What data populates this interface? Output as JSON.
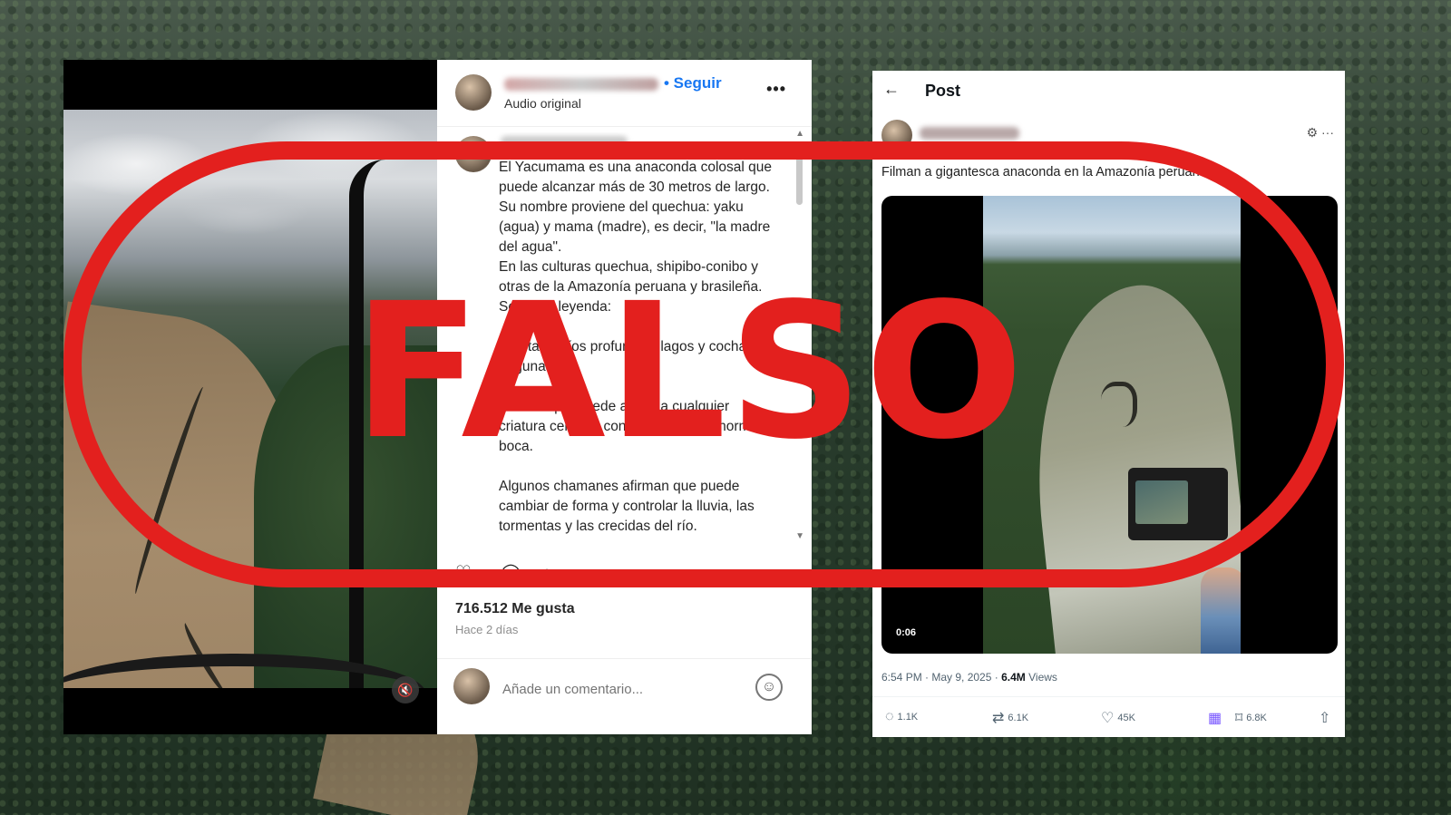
{
  "left_video": {
    "mute_icon": "muted-speaker-icon",
    "settings_icon": "gear-icon"
  },
  "instagram": {
    "follow_label": "• Seguir",
    "audio_label": "Audio original",
    "more_icon": "•••",
    "caption": "El Yacumama es una anaconda colosal que puede alcanzar más de 30 metros de largo. Su nombre proviene del quechua: yaku (agua) y mama (madre), es decir, \"la madre del agua\".\nEn las culturas quechua, shipibo-conibo y otras de la Amazonía peruana y brasileña. Según la leyenda:\n\nHabita en ríos profundos, lagos y cochas (lagunas).\n\nSe dice que puede atraer a cualquier criatura cercana con solo abrir su enorme boca.\n\nAlgunos chamanes afirman que puede cambiar de forma y controlar la lluvia, las tormentas y las crecidas del río.",
    "likes": "716.512 Me gusta",
    "time": "Hace 2 días",
    "comment_placeholder": "Añade un comentario...",
    "emoji_icon": "☺"
  },
  "x_post": {
    "back_icon": "←",
    "title": "Post",
    "text": "Filman a gigantesca anaconda en la Amazonía peruana",
    "duration": "0:06",
    "timestamp": "6:54 PM · May 9, 2025",
    "views": "6.4M",
    "views_label": "Views",
    "actions": {
      "replies": "1.1K",
      "reposts": "6.1K",
      "likes": "45K",
      "bookmarks": "6.8K"
    }
  },
  "stamp": {
    "word": "FALSO",
    "color": "#e3201e"
  }
}
